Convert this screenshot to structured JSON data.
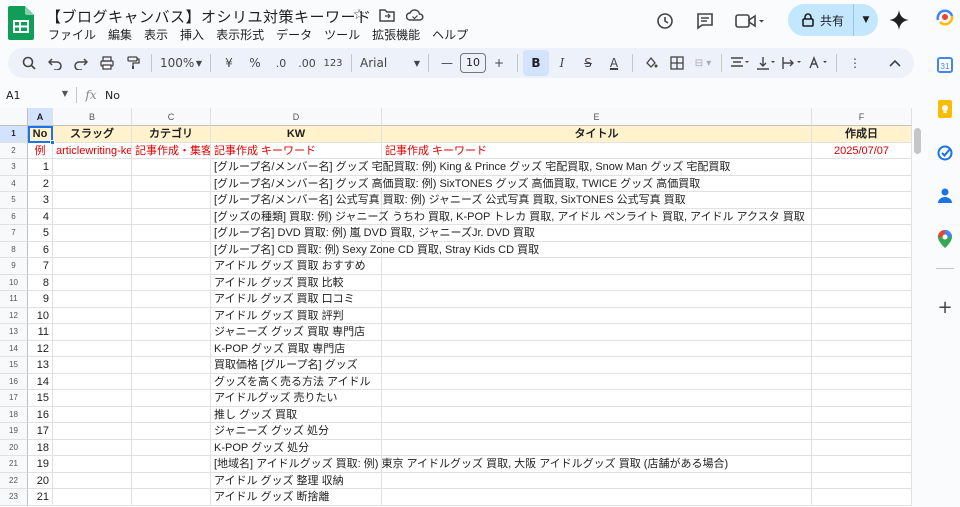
{
  "doc": {
    "title": "【ブログキャンバス】オシリユ対策キーワード"
  },
  "menu": [
    "ファイル",
    "編集",
    "表示",
    "挿入",
    "表示形式",
    "データ",
    "ツール",
    "拡張機能",
    "ヘルプ"
  ],
  "share": {
    "label": "共有"
  },
  "toolbar": {
    "zoom": "100%",
    "currency": "¥",
    "percent": "%",
    "dec_dec": ".0",
    "dec_inc": ".00",
    "num_format": "123",
    "font": "Arial",
    "font_size": "10"
  },
  "formula_bar": {
    "cell_ref": "A1",
    "content": "No"
  },
  "columns": [
    "A",
    "B",
    "C",
    "D",
    "E",
    "F"
  ],
  "header_row": {
    "no": "No",
    "slug": "スラッグ",
    "category": "カテゴリ",
    "kw": "KW",
    "title": "タイトル",
    "date": "作成日"
  },
  "example_row": {
    "no": "例",
    "slug": "articlewriting-keyword",
    "category": "記事作成・集客",
    "kw": "記事作成 キーワード",
    "title": "記事作成 キーワード",
    "date": "2025/07/07"
  },
  "rows": [
    {
      "no": "1",
      "kw": "[グループ名/メンバー名] グッズ 宅配買取: 例) King & Prince グッズ 宅配買取, Snow Man グッズ 宅配買取"
    },
    {
      "no": "2",
      "kw": "[グループ名/メンバー名] グッズ 高価買取: 例) SixTONES グッズ 高価買取, TWICE グッズ 高価買取"
    },
    {
      "no": "3",
      "kw": "[グループ名/メンバー名] 公式写真 買取: 例) ジャニーズ 公式写真 買取, SixTONES 公式写真 買取"
    },
    {
      "no": "4",
      "kw": "[グッズの種類] 買取: 例) ジャニーズ うちわ 買取, K-POP トレカ 買取, アイドル ペンライト 買取, アイドル アクスタ 買取"
    },
    {
      "no": "5",
      "kw": "[グループ名] DVD 買取: 例) 嵐 DVD 買取, ジャニーズJr. DVD 買取"
    },
    {
      "no": "6",
      "kw": "[グループ名] CD 買取: 例) Sexy Zone CD 買取, Stray Kids CD 買取"
    },
    {
      "no": "7",
      "kw": "アイドル グッズ 買取 おすすめ"
    },
    {
      "no": "8",
      "kw": "アイドル グッズ 買取 比較"
    },
    {
      "no": "9",
      "kw": "アイドル グッズ 買取 口コミ"
    },
    {
      "no": "10",
      "kw": "アイドル グッズ 買取 評判"
    },
    {
      "no": "11",
      "kw": "ジャニーズ グッズ 買取 専門店"
    },
    {
      "no": "12",
      "kw": "K-POP グッズ 買取 専門店"
    },
    {
      "no": "13",
      "kw": "買取価格 [グループ名] グッズ"
    },
    {
      "no": "14",
      "kw": "グッズを高く売る方法 アイドル"
    },
    {
      "no": "15",
      "kw": "アイドルグッズ 売りたい"
    },
    {
      "no": "16",
      "kw": "推し グッズ 買取"
    },
    {
      "no": "17",
      "kw": "ジャニーズ グッズ 処分"
    },
    {
      "no": "18",
      "kw": "K-POP グッズ 処分"
    },
    {
      "no": "19",
      "kw": "[地域名] アイドルグッズ 買取: 例) 東京 アイドルグッズ 買取, 大阪 アイドルグッズ 買取 (店舗がある場合)"
    },
    {
      "no": "20",
      "kw": "アイドル グッズ 整理 収納"
    },
    {
      "no": "21",
      "kw": "アイドル グッズ 断捨離"
    }
  ],
  "colors": {
    "accent": "#1a73e8",
    "header_fill": "#fff2cc",
    "example_text": "#e00000",
    "share_bg": "#c2e7ff"
  }
}
